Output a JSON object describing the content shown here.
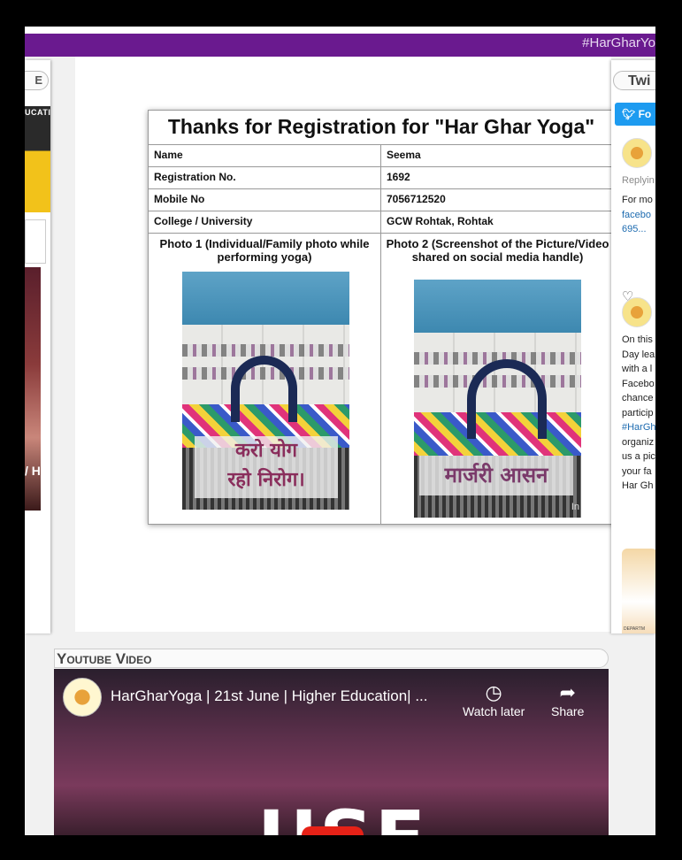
{
  "header": {
    "marquee_text": "#HarGharYo"
  },
  "left_widget": {
    "tab_label": "E",
    "banner_text": "UCATI",
    "photo_caption": "/ Hi"
  },
  "registration": {
    "title": "Thanks for Registration for \"Har Ghar Yoga\"",
    "rows": [
      {
        "label": "Name",
        "value": "Seema"
      },
      {
        "label": "Registration No.",
        "value": "1692"
      },
      {
        "label": "Mobile No",
        "value": "7056712520"
      },
      {
        "label": "College / University",
        "value": "GCW Rohtak, Rohtak"
      }
    ],
    "photo1_caption": "Photo 1 (Individual/Family photo while performing yoga)",
    "photo2_caption": "Photo 2 (Screenshot of the Picture/Video shared on social media handle)",
    "photo1_overlay_line1": "करो योग",
    "photo1_overlay_line2": "रहो निरोग।",
    "photo2_overlay": "मार्जरी आसन",
    "photo2_watermark": "In"
  },
  "twitter_widget": {
    "tab_label": "Twi",
    "follow_label": "Fo",
    "replying": "Replyin",
    "tweet1": [
      "For mo",
      "facebo",
      "695..."
    ],
    "tweet2": [
      "On this",
      "Day lea",
      "with a l",
      "Facebo",
      "chance",
      "particip",
      "#HarGh",
      "organiz",
      "us a pic",
      "your fa",
      "Har Gh"
    ],
    "card_text": "DEPARTM"
  },
  "youtube": {
    "section_label": "Youtube Video",
    "video_title": "HarGharYoga | 21st June | Higher Education| ...",
    "watch_later_label": "Watch later",
    "share_label": "Share",
    "overlay_text": "USE"
  }
}
